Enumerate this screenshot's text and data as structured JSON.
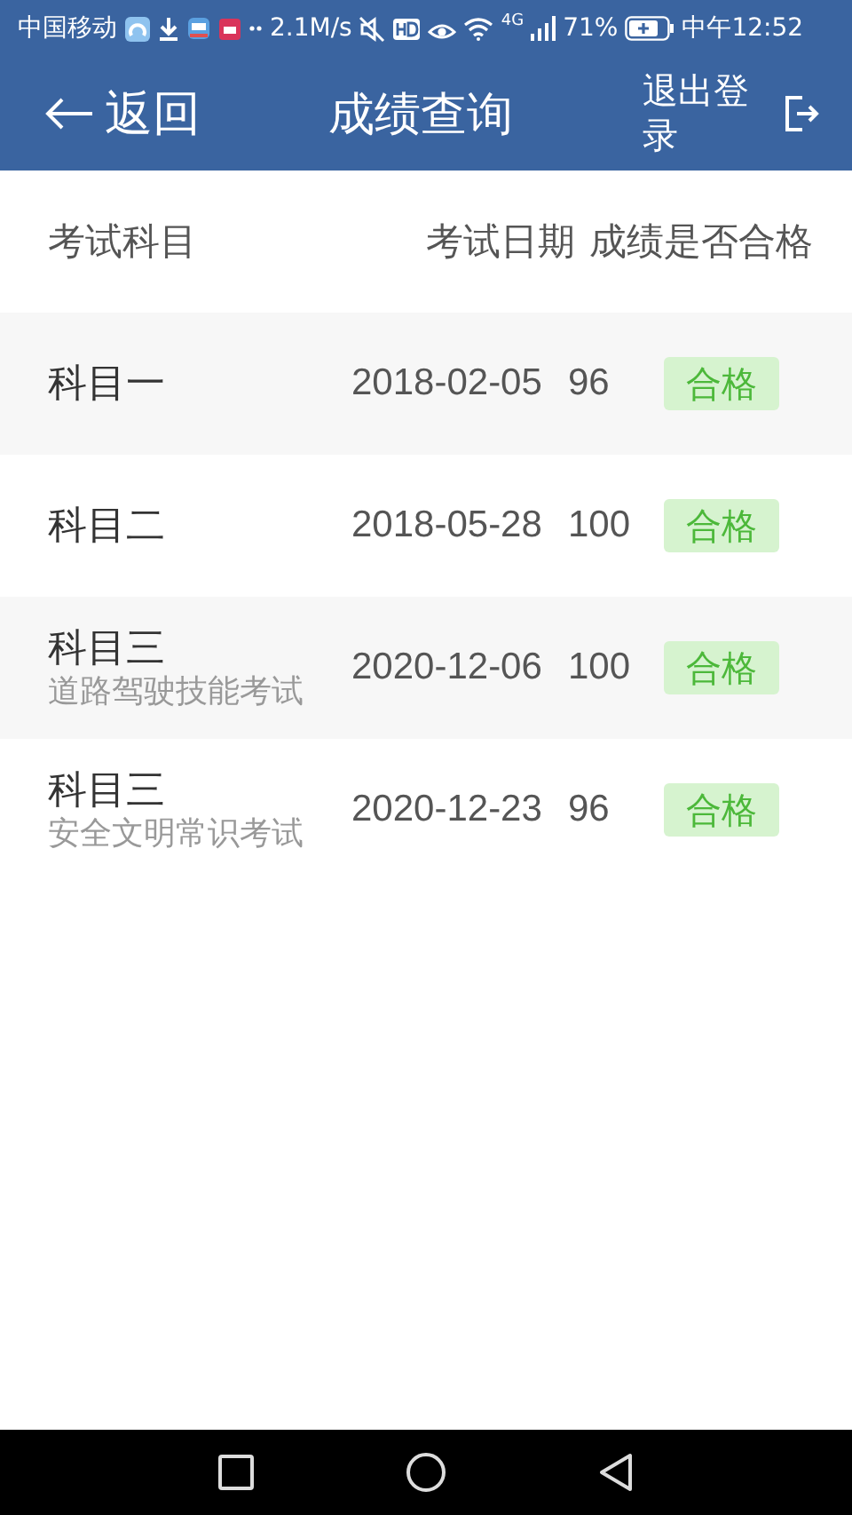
{
  "status_bar": {
    "carrier": "中国移动",
    "speed": "2.1M/s",
    "network": "4G",
    "battery": "71%",
    "time": "中午12:52"
  },
  "header": {
    "back": "返回",
    "title": "成绩查询",
    "logout": "退出登录"
  },
  "table": {
    "columns": [
      "考试科目",
      "考试日期",
      "成绩是否合格"
    ],
    "rows": [
      {
        "subject": "科目一",
        "date": "2018-02-05",
        "score": "96",
        "result": "合格"
      },
      {
        "subject": "科目二",
        "date": "2018-05-28",
        "score": "100",
        "result": "合格"
      },
      {
        "subject": "科目三",
        "subtitle": "道路驾驶技能考试",
        "date": "2020-12-06",
        "score": "100",
        "result": "合格"
      },
      {
        "subject": "科目三",
        "subtitle": "安全文明常识考试",
        "date": "2020-12-23",
        "score": "96",
        "result": "合格"
      }
    ]
  }
}
